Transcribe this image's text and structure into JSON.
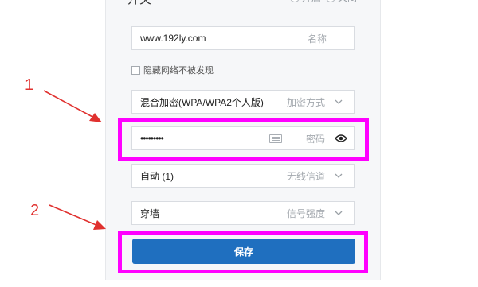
{
  "header": {
    "title": "开关",
    "options": [
      "开启",
      "关闭"
    ]
  },
  "form": {
    "ssid": {
      "value": "www.192ly.com",
      "label": "名称"
    },
    "hide_network": {
      "label": "隐藏网络不被发现",
      "checked": false
    },
    "encryption": {
      "value": "混合加密(WPA/WPA2个人版)",
      "label": "加密方式"
    },
    "password": {
      "value": "•••••••••",
      "label": "密码"
    },
    "channel": {
      "value": "自动 (1)",
      "label": "无线信道"
    },
    "signal": {
      "value": "穿墙",
      "label": "信号强度"
    },
    "save_label": "保存"
  },
  "annotations": {
    "step1": "1",
    "step2": "2"
  },
  "colors": {
    "highlight": "#ff00ff",
    "arrow": "#e0312f",
    "primary": "#1f6fbf"
  }
}
